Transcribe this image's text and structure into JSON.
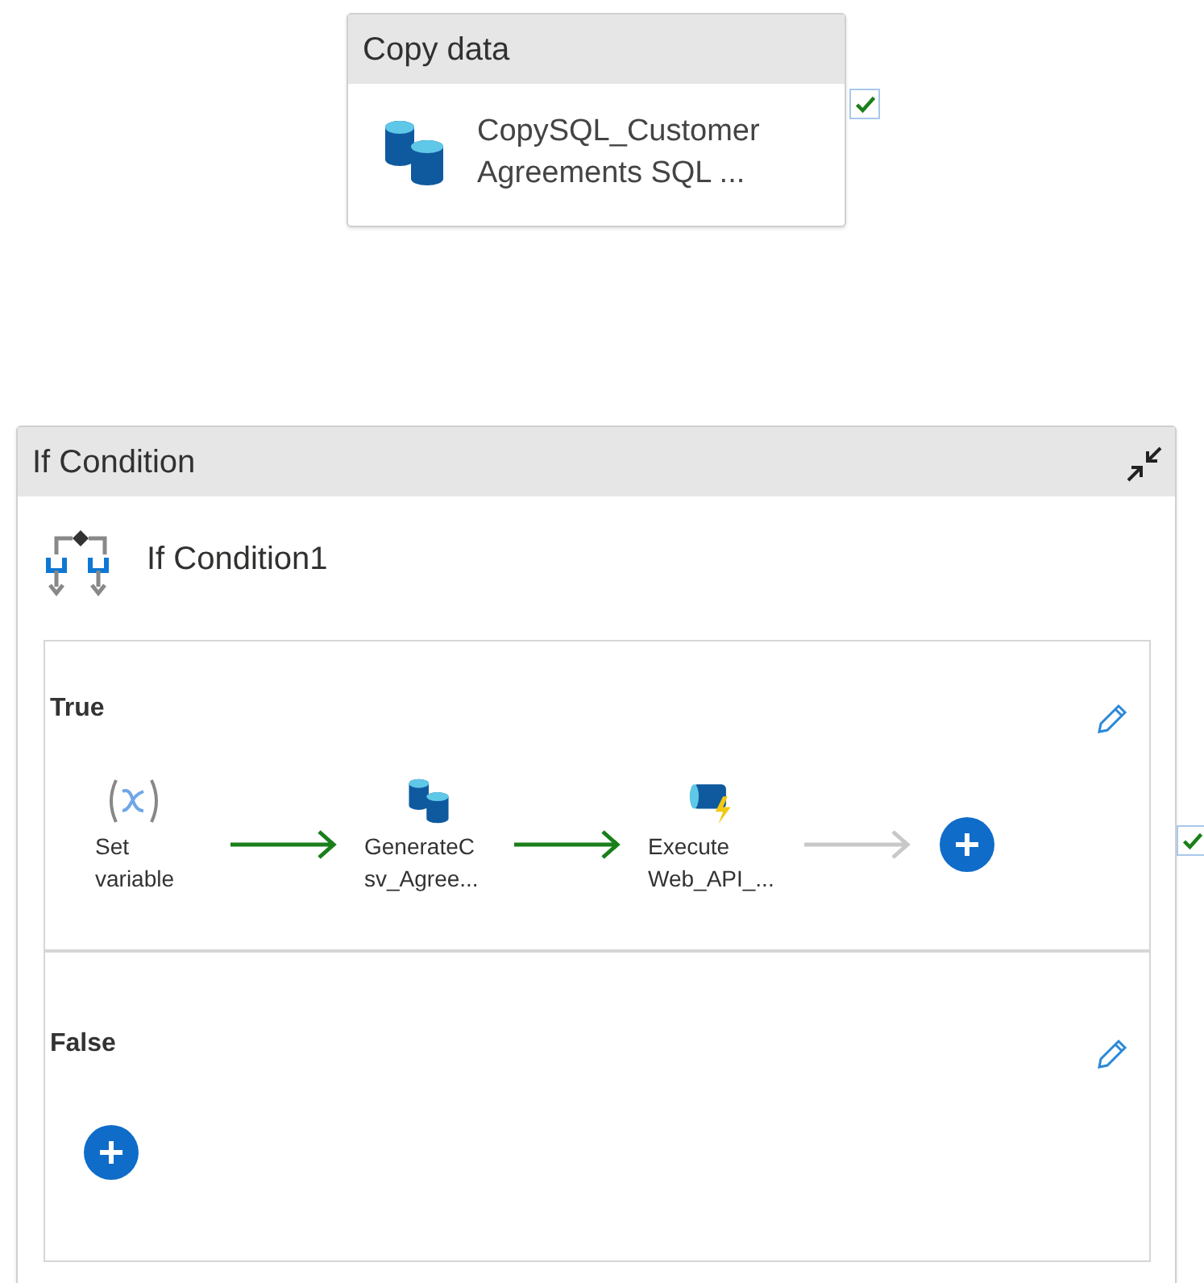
{
  "copy_activity": {
    "type_label": "Copy data",
    "name": "CopySQL_Customer\nAgreements SQL ...",
    "succeeded": true
  },
  "if_condition": {
    "type_label": "If Condition",
    "name": "If Condition1",
    "succeeded": true,
    "branches": [
      {
        "label": "True",
        "activities": [
          {
            "kind": "set_variable",
            "name": "Set\nvariable"
          },
          {
            "kind": "copy",
            "name": "GenerateC\nsv_Agree..."
          },
          {
            "kind": "web",
            "name": "Execute\nWeb_API_..."
          }
        ]
      },
      {
        "label": "False"
      }
    ]
  }
}
